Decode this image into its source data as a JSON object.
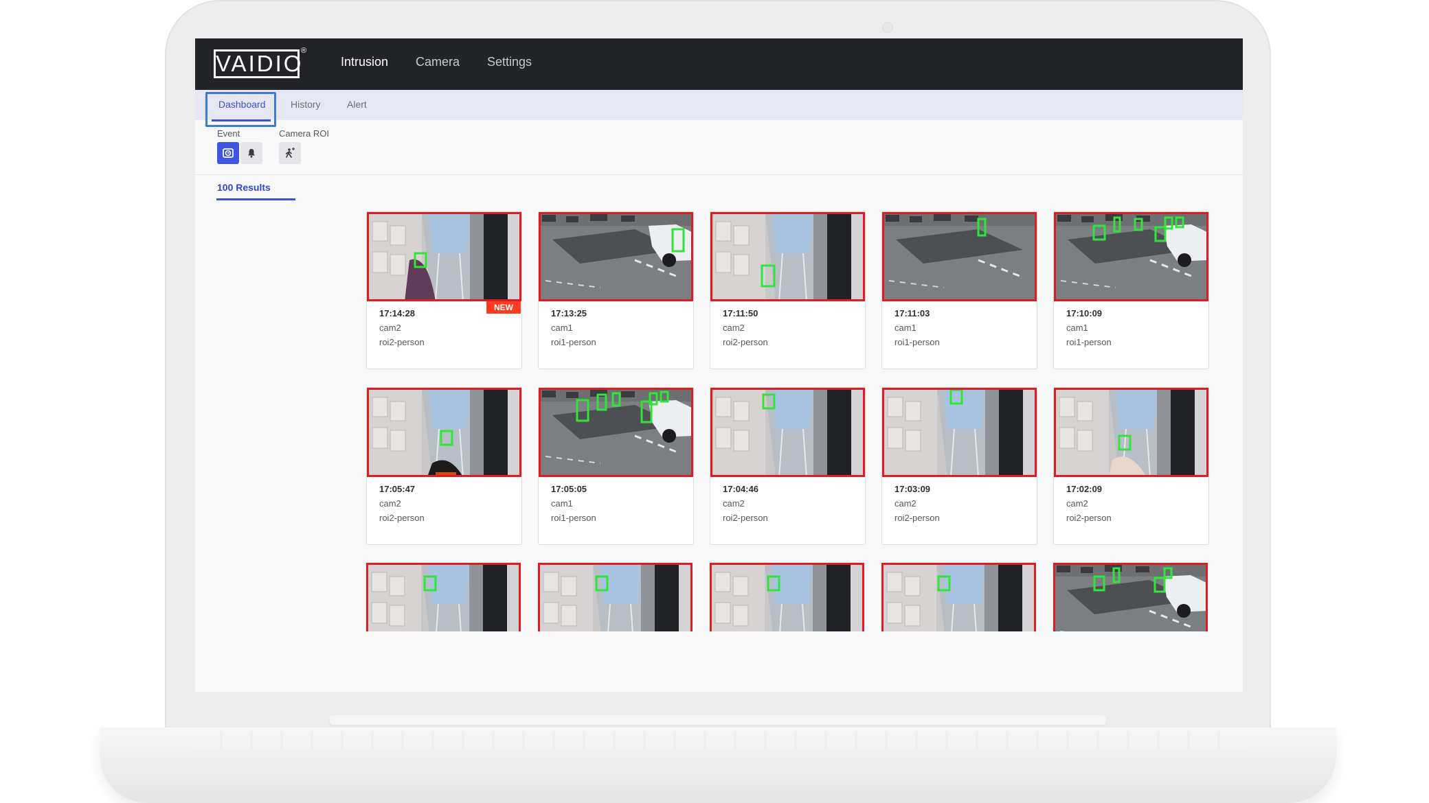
{
  "app": {
    "logo_text": "VAIDIO",
    "logo_mark": "®",
    "nav": [
      "Intrusion",
      "Camera",
      "Settings"
    ],
    "active_nav": "Intrusion"
  },
  "subnav": {
    "tabs": [
      "Dashboard",
      "History",
      "Alert"
    ],
    "active": "Dashboard"
  },
  "filters": {
    "event_label": "Event",
    "camera_roi_label": "Camera ROI"
  },
  "results": {
    "count_label": "100 Results"
  },
  "colors": {
    "accent": "#3f55e0",
    "topbar": "#222427",
    "roi_border": "#e11b22",
    "detection_box": "#2fe53a",
    "new_badge": "#ff3b1f"
  },
  "events": [
    {
      "time": "17:14:28",
      "cam": "cam2",
      "type": "roi2-person",
      "scene": "corridor",
      "new": true,
      "new_label": "NEW"
    },
    {
      "time": "17:13:25",
      "cam": "cam1",
      "type": "roi1-person",
      "scene": "street"
    },
    {
      "time": "17:11:50",
      "cam": "cam2",
      "type": "roi2-person",
      "scene": "corridor"
    },
    {
      "time": "17:11:03",
      "cam": "cam1",
      "type": "roi1-person",
      "scene": "street"
    },
    {
      "time": "17:10:09",
      "cam": "cam1",
      "type": "roi1-person",
      "scene": "street"
    },
    {
      "time": "17:05:47",
      "cam": "cam2",
      "type": "roi2-person",
      "scene": "corridor"
    },
    {
      "time": "17:05:05",
      "cam": "cam1",
      "type": "roi1-person",
      "scene": "street"
    },
    {
      "time": "17:04:46",
      "cam": "cam2",
      "type": "roi2-person",
      "scene": "corridor"
    },
    {
      "time": "17:03:09",
      "cam": "cam2",
      "type": "roi2-person",
      "scene": "corridor"
    },
    {
      "time": "17:02:09",
      "cam": "cam2",
      "type": "roi2-person",
      "scene": "corridor"
    },
    {
      "scene": "corridor"
    },
    {
      "scene": "corridor"
    },
    {
      "scene": "corridor"
    },
    {
      "scene": "corridor"
    },
    {
      "scene": "street"
    }
  ]
}
